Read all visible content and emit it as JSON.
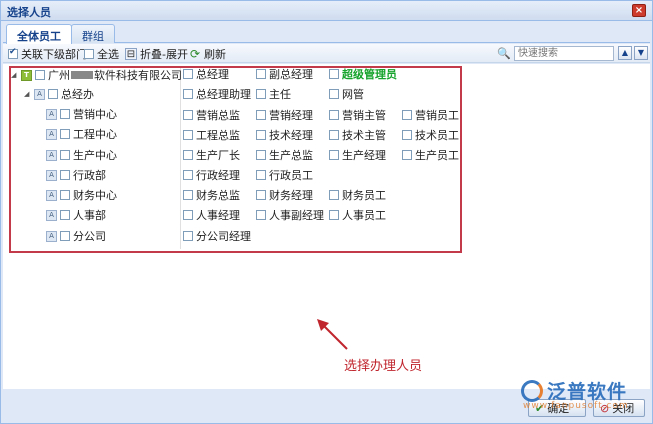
{
  "window": {
    "title": "选择人员",
    "close_glyph": "×"
  },
  "tabs": [
    {
      "label": "全体员工",
      "active": true
    },
    {
      "label": "群组",
      "active": false
    }
  ],
  "toolbar": {
    "include_sub_depts_label": "关联下级部门",
    "include_sub_depts_checked": true,
    "select_all_label": "全选",
    "select_all_checked": false,
    "collapse_expand_label": "折叠-展开",
    "refresh_label": "刷新",
    "search_placeholder": "快速搜索"
  },
  "tree": {
    "root": {
      "prefix": "广州",
      "suffix": "软件科技有限公司",
      "icon": "T"
    },
    "level1": {
      "label": "总经办"
    },
    "depts": [
      {
        "label": "营销中心"
      },
      {
        "label": "工程中心"
      },
      {
        "label": "生产中心"
      },
      {
        "label": "行政部"
      },
      {
        "label": "财务中心"
      },
      {
        "label": "人事部"
      },
      {
        "label": "分公司"
      }
    ]
  },
  "roles": [
    [
      "总经理",
      "副总经理",
      "超级管理员",
      ""
    ],
    [
      "总经理助理",
      "主任",
      "网管",
      ""
    ],
    [
      "营销总监",
      "营销经理",
      "营销主管",
      "营销员工"
    ],
    [
      "工程总监",
      "技术经理",
      "技术主管",
      "技术员工"
    ],
    [
      "生产厂长",
      "生产总监",
      "生产经理",
      "生产员工"
    ],
    [
      "行政经理",
      "行政员工",
      "",
      ""
    ],
    [
      "财务总监",
      "财务经理",
      "财务员工",
      ""
    ],
    [
      "人事经理",
      "人事副经理",
      "人事员工",
      ""
    ],
    [
      "分公司经理",
      "",
      "",
      ""
    ]
  ],
  "highlight_role": "超级管理员",
  "annotation": {
    "text": "选择办理人员",
    "color": "#c0262e"
  },
  "footer": {
    "ok_label": "确定",
    "close_label": "关闭"
  },
  "watermark": {
    "brand": "泛普软件",
    "url": "www.fanpusoft.com"
  },
  "colors": {
    "accent": "#15428b",
    "annotation": "#c33a4a",
    "super_admin": "#16a32c"
  }
}
